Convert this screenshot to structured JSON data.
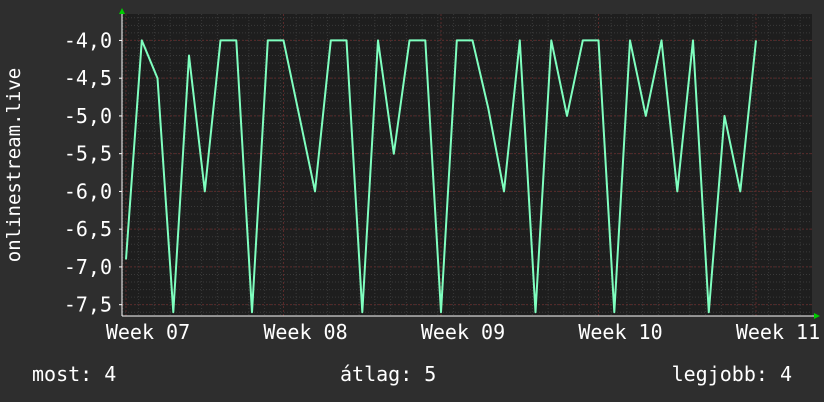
{
  "chart_data": {
    "type": "line",
    "ylabel": "onlinestream.live",
    "xlabel": "",
    "x_ticks": [
      "Week 07",
      "Week 08",
      "Week 09",
      "Week 10",
      "Week 11"
    ],
    "y_ticks": [
      "-4,0",
      "-4,5",
      "-5,0",
      "-5,5",
      "-6,0",
      "-6,5",
      "-7,0",
      "-7,5"
    ],
    "ylim": [
      -7.65,
      -3.65
    ],
    "grid": true,
    "series": [
      {
        "color": "#7fffbf",
        "x": [
          0.0,
          0.1,
          0.2,
          0.3,
          0.4,
          0.5,
          0.6,
          0.7,
          0.8,
          0.9,
          1.0,
          1.1,
          1.2,
          1.3,
          1.4,
          1.5,
          1.6,
          1.7,
          1.8,
          1.9,
          2.0,
          2.1,
          2.2,
          2.3,
          2.4,
          2.5,
          2.6,
          2.7,
          2.8,
          2.9,
          3.0,
          3.1,
          3.2,
          3.3,
          3.4,
          3.5,
          3.6,
          3.7,
          3.8,
          3.9,
          4.0
        ],
        "values": [
          -6.9,
          -4.0,
          -4.5,
          -7.6,
          -4.2,
          -6.0,
          -4.0,
          -4.0,
          -7.6,
          -4.0,
          -4.0,
          -5.0,
          -6.0,
          -4.0,
          -4.0,
          -7.6,
          -4.0,
          -5.5,
          -4.0,
          -4.0,
          -7.6,
          -4.0,
          -4.0,
          -4.9,
          -6.0,
          -4.0,
          -7.6,
          -4.0,
          -5.0,
          -4.0,
          -4.0,
          -7.6,
          -4.0,
          -5.0,
          -4.0,
          -6.0,
          -4.0,
          -7.6,
          -5.0,
          -6.0,
          -4.0
        ]
      }
    ]
  },
  "footer": {
    "now": "most: 4",
    "avg": "átlag: 5",
    "best": "legjobb: 4"
  }
}
